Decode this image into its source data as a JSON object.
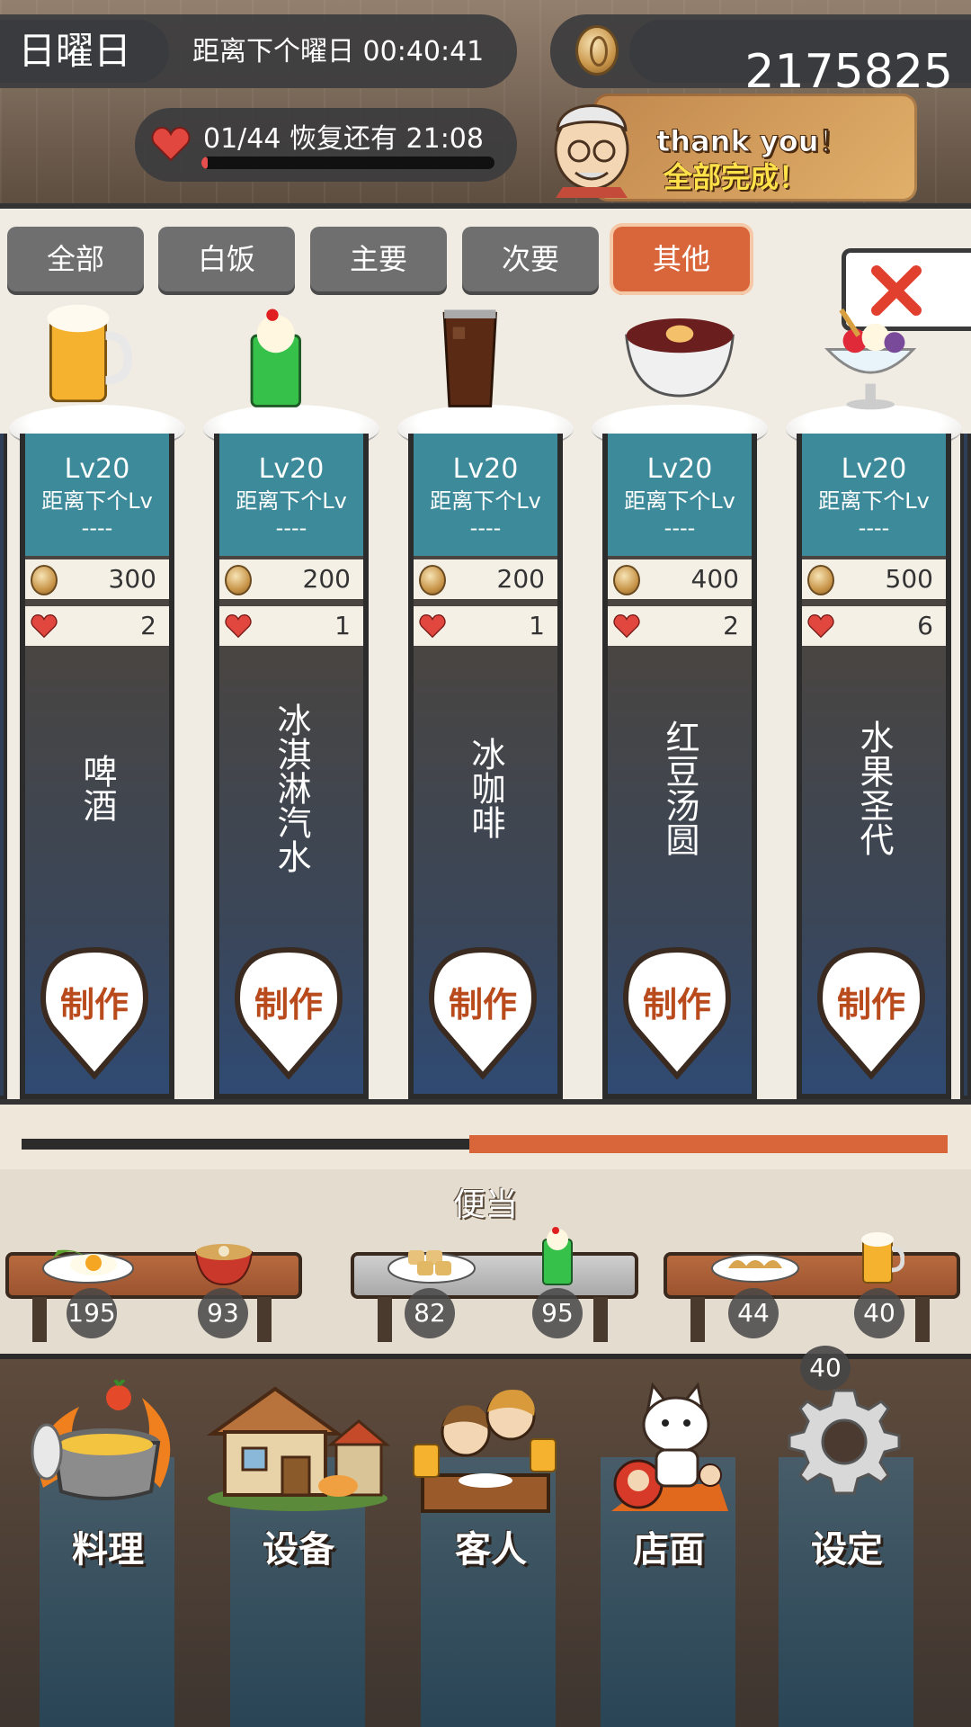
{
  "header": {
    "day": "日曜日",
    "next_day_text": "距离下个曜日 00:40:41",
    "money": "2175825",
    "stamina_text": "01/44  恢复还有  21:08",
    "stamina_fraction": 0.023,
    "banner_thanks": "thank you！",
    "banner_done": "全部完成！"
  },
  "tabs": [
    "全部",
    "白饭",
    "主要",
    "次要",
    "其他"
  ],
  "active_tab": "其他",
  "foods": [
    {
      "lv": "Lv20",
      "next": "距离下个Lv",
      "dash": "----",
      "price": "300",
      "hearts": "2",
      "name": "啤酒",
      "make": "制作",
      "icon": "beer-icon"
    },
    {
      "lv": "Lv20",
      "next": "距离下个Lv",
      "dash": "----",
      "price": "200",
      "hearts": "1",
      "name": "冰淇淋汽水",
      "make": "制作",
      "icon": "cream-soda-icon"
    },
    {
      "lv": "Lv20",
      "next": "距离下个Lv",
      "dash": "----",
      "price": "200",
      "hearts": "1",
      "name": "冰咖啡",
      "make": "制作",
      "icon": "iced-coffee-icon"
    },
    {
      "lv": "Lv20",
      "next": "距离下个Lv",
      "dash": "----",
      "price": "400",
      "hearts": "2",
      "name": "红豆汤圆",
      "make": "制作",
      "icon": "red-bean-soup-icon"
    },
    {
      "lv": "Lv20",
      "next": "距离下个Lv",
      "dash": "----",
      "price": "500",
      "hearts": "6",
      "name": "水果圣代",
      "make": "制作",
      "icon": "fruit-sundae-icon"
    }
  ],
  "scroll_position": 0.5,
  "bento": {
    "title": "便当",
    "counts": [
      "195",
      "93",
      "82",
      "95",
      "44",
      "40"
    ],
    "extra_count": "40"
  },
  "nav": [
    "料理",
    "设备",
    "客人",
    "店面",
    "设定"
  ],
  "colors": {
    "accent": "#d9653a",
    "teal": "#3d8a9a",
    "make_text": "#b84a1c"
  }
}
